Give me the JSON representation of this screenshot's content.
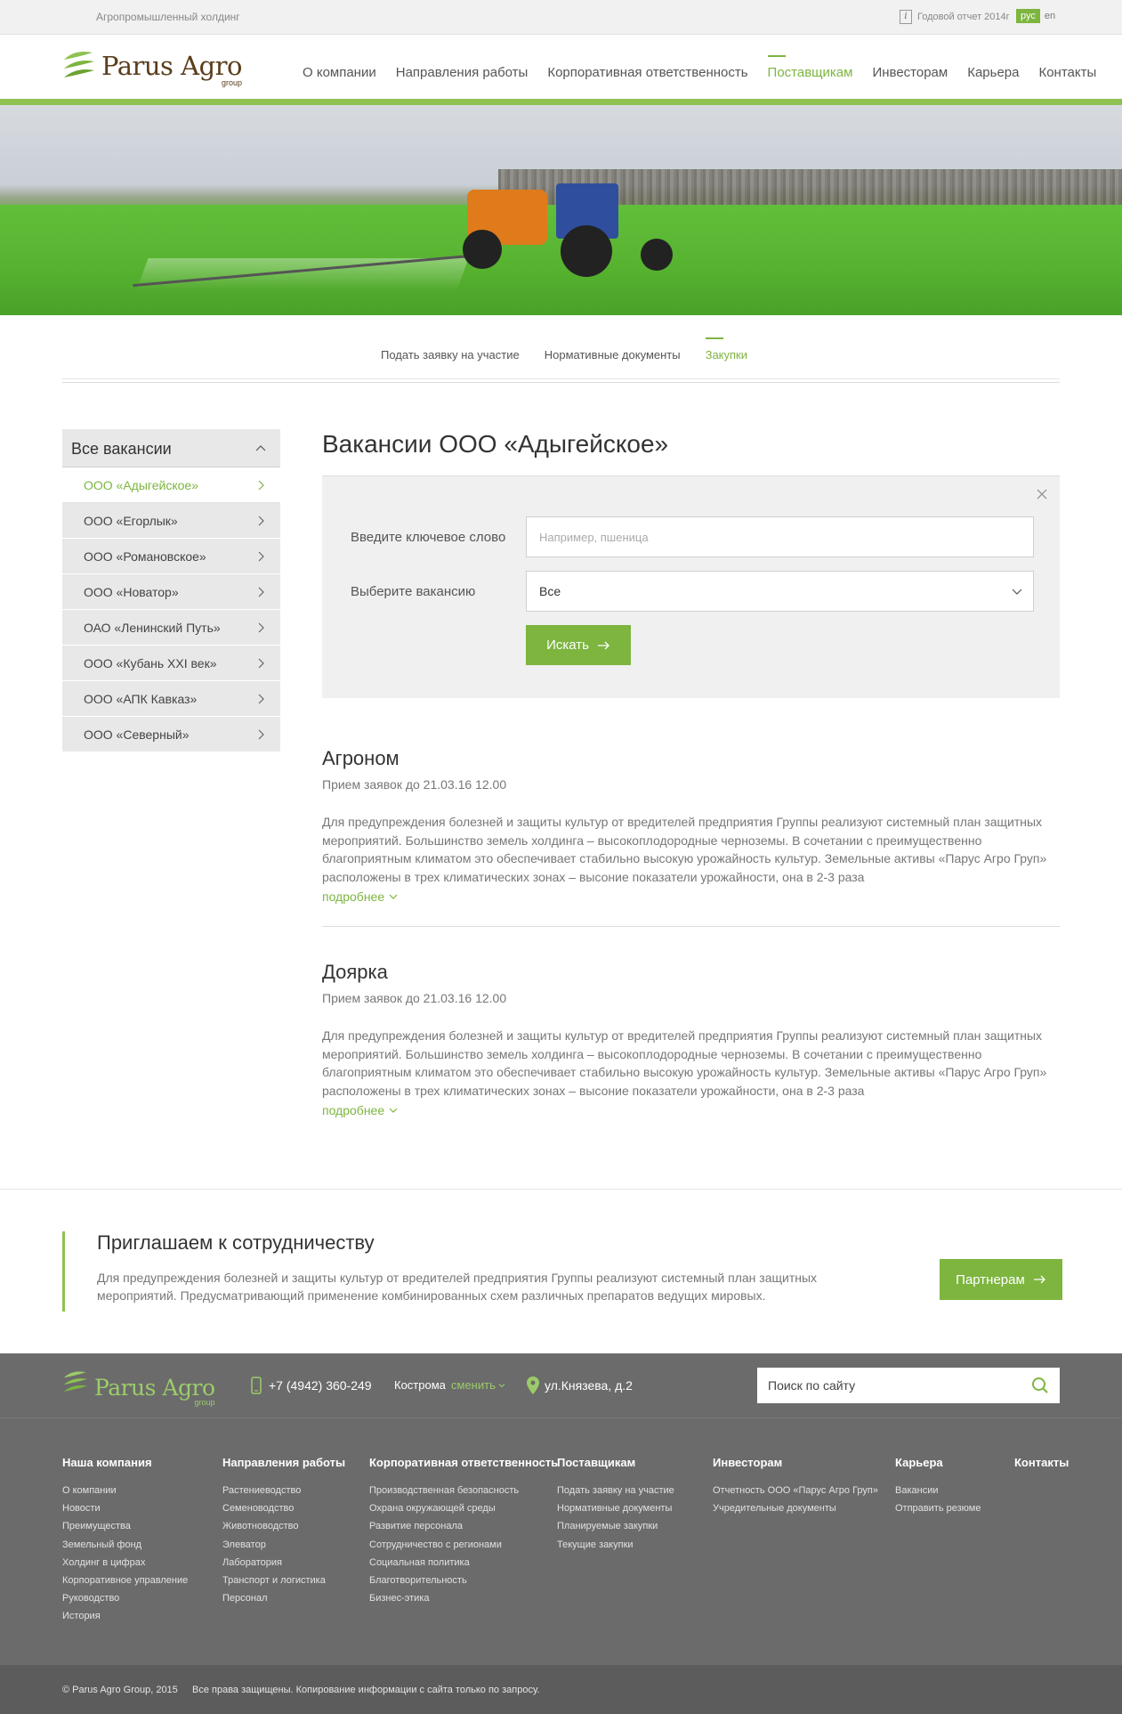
{
  "topbar": {
    "tagline": "Агропромышленный холдинг",
    "report_label": "Годовой отчет 2014г",
    "languages": [
      {
        "label": "рус",
        "active": true
      },
      {
        "label": "en",
        "active": false
      }
    ]
  },
  "header": {
    "logo_text": "Parus Agro",
    "logo_sub": "group",
    "nav": [
      {
        "label": "О компании",
        "active": false
      },
      {
        "label": "Направления работы",
        "active": false
      },
      {
        "label": "Корпоративная ответственность",
        "active": false
      },
      {
        "label": "Поставщикам",
        "active": true
      },
      {
        "label": "Инвесторам",
        "active": false
      },
      {
        "label": "Карьера",
        "active": false
      },
      {
        "label": "Контакты",
        "active": false
      }
    ]
  },
  "subnav": [
    {
      "label": "Подать заявку на участие",
      "active": false
    },
    {
      "label": "Нормативные документы",
      "active": false
    },
    {
      "label": "Закупки",
      "active": true
    }
  ],
  "sidebar": {
    "heading": "Все вакансии",
    "items": [
      {
        "label": "ООО «Адыгейское»",
        "active": true
      },
      {
        "label": "ООО «Егорлык»",
        "active": false
      },
      {
        "label": "ООО «Романовское»",
        "active": false
      },
      {
        "label": "ООО «Новатор»",
        "active": false
      },
      {
        "label": "ОАО «Ленинский Путь»",
        "active": false
      },
      {
        "label": "ООО «Кубань XXI век»",
        "active": false
      },
      {
        "label": "ООО «АПК Кавказ»",
        "active": false
      },
      {
        "label": "ООО «Северный»",
        "active": false
      }
    ]
  },
  "main": {
    "title": "Вакансии ООО «Адыгейское»",
    "filter": {
      "keyword_label": "Введите ключевое слово",
      "keyword_placeholder": "Например, пшеница",
      "keyword_value": "",
      "vacancy_label": "Выберите вакансию",
      "vacancy_value": "Все",
      "search_button": "Искать"
    },
    "vacancies": [
      {
        "title": "Агроном",
        "date": "Прием заявок до 21.03.16 12.00",
        "text": "Для предупреждения болезней и защиты культур от вредителей предприятия Группы реализуют системный план защитных мероприятий. Большинство земель холдинга – высокоплодородные черноземы. В сочетании с преимущественно благоприятным климатом это обеспечивает стабильно высокую урожайность культур. Земельные активы «Парус Агро Груп» расположены в трех климатических зонах –  высоние показатели урожайности, она в 2-3 раза",
        "more": "подробнее"
      },
      {
        "title": "Доярка",
        "date": "Прием заявок до 21.03.16 12.00",
        "text": "Для предупреждения болезней и защиты культур от вредителей предприятия Группы реализуют системный план защитных мероприятий. Большинство земель холдинга – высокоплодородные черноземы. В сочетании с преимущественно благоприятным климатом это обеспечивает стабильно высокую урожайность культур. Земельные активы «Парус Агро Груп» расположены в трех климатических зонах –  высоние показатели урожайности, она в 2-3 раза",
        "more": "подробнее"
      }
    ]
  },
  "invite": {
    "title": "Приглашаем к сотрудничеству",
    "text": "Для предупреждения болезней и защиты культур от вредителей предприятия Группы реализуют системный план защитных мероприятий. Предусматривающий применение комбинированных схем различных препаратов ведущих мировых.",
    "button": "Партнерам"
  },
  "footer": {
    "phone": "+7 (4942) 360-249",
    "city": "Кострома",
    "change_city": "сменить",
    "address": "ул.Князева, д.2",
    "search_placeholder": "Поиск по сайту",
    "columns": [
      {
        "title": "Наша компания",
        "links": [
          "О компании",
          "Новости",
          "Преимущества",
          "Земельный фонд",
          "Холдинг в цифрах",
          "Корпоративное управление",
          "Руководство",
          "История"
        ]
      },
      {
        "title": "Направления работы",
        "links": [
          "Растениеводство",
          "Семеноводство",
          "Животноводство",
          "Элеватор",
          "Лаборатория",
          "Транспорт и логистика",
          "Персонал"
        ]
      },
      {
        "title": "Корпоративная ответственность",
        "links": [
          "Производственная безопасность",
          "Охрана окружающей среды",
          "Развитие персонала",
          "Сотрудничество с регионами",
          "Социальная политика",
          "Благотворительность",
          "Бизнес-этика"
        ]
      },
      {
        "title": "Поставщикам",
        "links": [
          "Подать заявку на участие",
          "Нормативные документы",
          "Планируемые закупки",
          "Текущие закупки"
        ]
      },
      {
        "title": "Инвесторам",
        "links": [
          "Отчетность ООО «Парус Агро Груп»",
          "Учредительные документы"
        ]
      },
      {
        "title": "Карьера",
        "links": [
          "Вакансии",
          "Отправить резюме"
        ]
      },
      {
        "title": "Контакты",
        "links": []
      }
    ],
    "copyright": "© Parus Agro Group, 2015",
    "rights": "Все права защищены. Копирование информации с сайта  только по запросу."
  },
  "colors": {
    "accent": "#7db53f",
    "accent_light": "#8ec152",
    "footer_bg": "#6b6b6b",
    "footer_bottom_bg": "#5c5c5c"
  },
  "icons": [
    "info-icon",
    "logo-leaf-icon",
    "chevron-up-icon",
    "chevron-right-icon",
    "close-icon",
    "chevron-down-icon",
    "arrow-right-icon",
    "phone-icon",
    "map-pin-icon",
    "search-icon"
  ]
}
